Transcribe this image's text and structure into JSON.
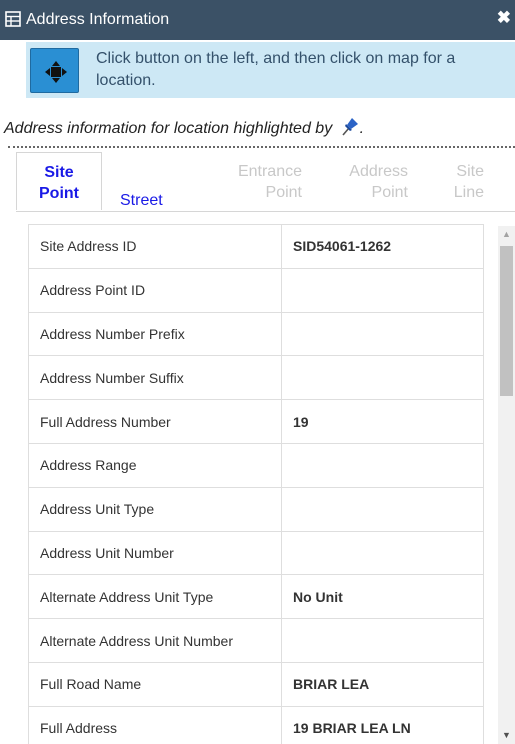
{
  "header": {
    "title": "Address Information",
    "title_icon": "table-icon",
    "close_icon": "close-icon",
    "close_symbol": "✖"
  },
  "instruction": {
    "button_icon": "crosshair-locate-icon",
    "text": "Click button on the left, and then click on map for a location."
  },
  "highlight_note": {
    "text": "Address information for location highlighted by",
    "suffix": ".",
    "icon": "pushpin-icon"
  },
  "tabs": [
    {
      "line1": "Site",
      "line2": "Point",
      "state": "active"
    },
    {
      "line1": "Street",
      "line2": "",
      "state": "link"
    },
    {
      "line1": "Entrance",
      "line2": "Point",
      "state": "disabled"
    },
    {
      "line1": "Address",
      "line2": "Point",
      "state": "disabled"
    },
    {
      "line1": "Site",
      "line2": "Line",
      "state": "disabled"
    }
  ],
  "attributes": {
    "rows": [
      {
        "label": "Site Address ID",
        "value": "SID54061-1262"
      },
      {
        "label": "Address Point ID",
        "value": ""
      },
      {
        "label": "Address Number Prefix",
        "value": ""
      },
      {
        "label": "Address Number Suffix",
        "value": ""
      },
      {
        "label": "Full Address Number",
        "value": "19"
      },
      {
        "label": "Address Range",
        "value": ""
      },
      {
        "label": "Address Unit Type",
        "value": ""
      },
      {
        "label": "Address Unit Number",
        "value": ""
      },
      {
        "label": "Alternate Address Unit Type",
        "value": "No Unit"
      },
      {
        "label": "Alternate Address Unit Number",
        "value": ""
      },
      {
        "label": "Full Road Name",
        "value": "BRIAR LEA"
      },
      {
        "label": "Full Address",
        "value": "19 BRIAR LEA LN"
      }
    ]
  },
  "scrollbar": {
    "up_symbol": "▲",
    "down_symbol": "▼"
  },
  "colors": {
    "titlebar": "#3b5166",
    "instruction_bg": "#cde8f5",
    "button": "#2a8fd3",
    "tab_link": "#1a1ae6",
    "tab_disabled": "#c8c8c8"
  }
}
